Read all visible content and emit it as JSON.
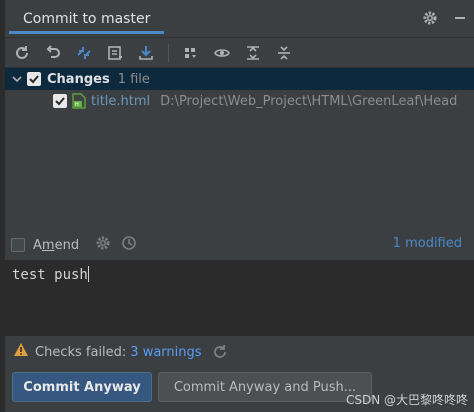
{
  "window": {
    "tab_title": "Commit to master"
  },
  "toolbar": {
    "buttons": [
      "refresh-icon",
      "rollback-icon",
      "diff-icon",
      "shelve-icon",
      "update-icon",
      "group-by-icon",
      "eye-icon",
      "expand-all-icon",
      "collapse-all-icon"
    ]
  },
  "tree": {
    "group_label": "Changes",
    "group_count": "1 file",
    "file": {
      "name": "title.html",
      "path": "D:\\Project\\Web_Project\\HTML\\GreenLeaf\\Head"
    }
  },
  "amend": {
    "label_prefix": "A",
    "label_underline": "m",
    "label_suffix": "end",
    "modified": "1 modified"
  },
  "message": {
    "text": "test push"
  },
  "checks": {
    "status": "Checks failed:",
    "link": "3 warnings"
  },
  "buttons": {
    "commit_anyway": "Commit Anyway",
    "commit_and_push": "Commit Anyway and Push..."
  },
  "watermark": "CSDN @大巴黎咚咚咚",
  "colors": {
    "accent": "#4a88c7",
    "link": "#589df6",
    "warning": "#e0a040",
    "file_green": "#62b543"
  }
}
